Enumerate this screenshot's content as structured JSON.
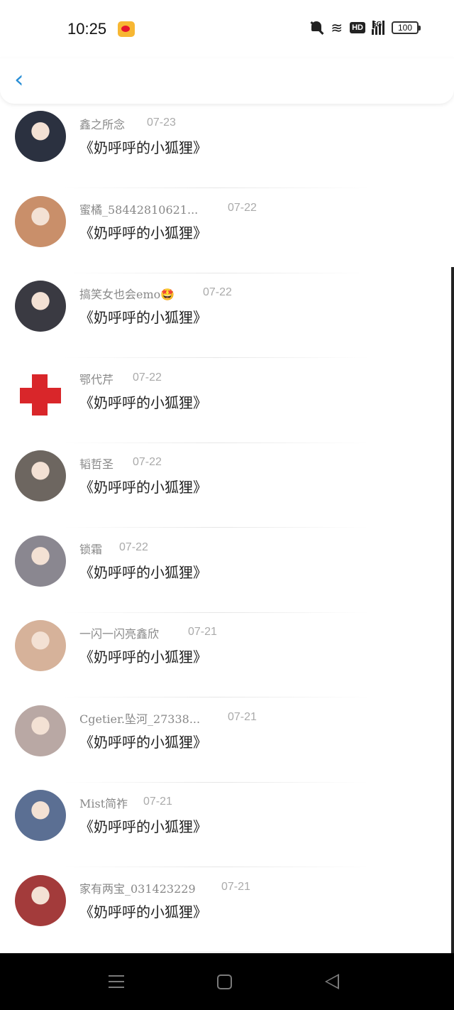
{
  "status_bar": {
    "time": "10:25",
    "notification_app": "weibo-icon",
    "icons": [
      "bell-muted-icon",
      "wifi-icon",
      "hd-icon",
      "5g-signal-icon",
      "battery-icon"
    ],
    "hd": "HD",
    "network": "5G",
    "battery": "100"
  },
  "header": {
    "back_icon": "chevron-left-icon",
    "back_glyph": "‹",
    "accent": "#2a8fd6"
  },
  "list": {
    "items": [
      {
        "name": "鑫之所念",
        "date": "07-23",
        "message": "《奶呼呼的小狐狸》",
        "avatar_color": "#2b3140"
      },
      {
        "name": "蜜橘_58442810621...",
        "date": "07-22",
        "message": "《奶呼呼的小狐狸》",
        "avatar_color": "#c98f6a"
      },
      {
        "name": "搞笑女也会emo🤩",
        "date": "07-22",
        "message": "《奶呼呼的小狐狸》",
        "avatar_color": "#3a3a42"
      },
      {
        "name": "鄂代芹",
        "date": "07-22",
        "message": "《奶呼呼的小狐狸》",
        "avatar_color": "#d9262a"
      },
      {
        "name": "韬哲圣",
        "date": "07-22",
        "message": "《奶呼呼的小狐狸》",
        "avatar_color": "#6d6660"
      },
      {
        "name": "锁霜",
        "date": "07-22",
        "message": "《奶呼呼的小狐狸》",
        "avatar_color": "#8a8790"
      },
      {
        "name": "一闪一闪亮鑫欣",
        "date": "07-21",
        "message": "《奶呼呼的小狐狸》",
        "avatar_color": "#d6b29a"
      },
      {
        "name": "Cgetier.坠河_27338...",
        "date": "07-21",
        "message": "《奶呼呼的小狐狸》",
        "avatar_color": "#b9a8a4"
      },
      {
        "name": "Mist简祚",
        "date": "07-21",
        "message": "《奶呼呼的小狐狸》",
        "avatar_color": "#5b6f93"
      },
      {
        "name": "家有两宝_031423229",
        "date": "07-21",
        "message": "《奶呼呼的小狐狸》",
        "avatar_color": "#a33b3b"
      }
    ]
  },
  "nav_bar": {
    "icons": [
      "menu-icon",
      "home-icon",
      "back-triangle-icon"
    ]
  }
}
